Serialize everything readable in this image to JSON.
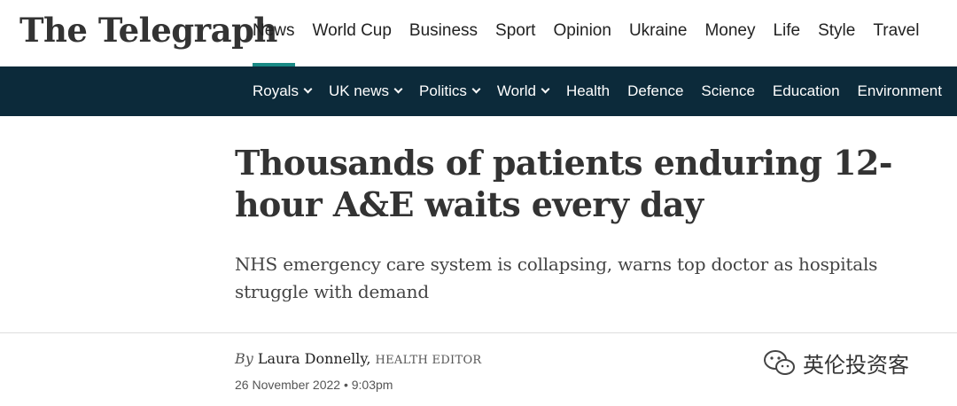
{
  "brand": {
    "logo_text": "The Telegraph"
  },
  "main_nav": [
    {
      "label": "News",
      "active": true
    },
    {
      "label": "World Cup"
    },
    {
      "label": "Business"
    },
    {
      "label": "Sport"
    },
    {
      "label": "Opinion"
    },
    {
      "label": "Ukraine"
    },
    {
      "label": "Money"
    },
    {
      "label": "Life"
    },
    {
      "label": "Style"
    },
    {
      "label": "Travel"
    }
  ],
  "sub_nav": [
    {
      "label": "Royals",
      "dropdown": true
    },
    {
      "label": "UK news",
      "dropdown": true
    },
    {
      "label": "Politics",
      "dropdown": true
    },
    {
      "label": "World",
      "dropdown": true
    },
    {
      "label": "Health"
    },
    {
      "label": "Defence"
    },
    {
      "label": "Science"
    },
    {
      "label": "Education"
    },
    {
      "label": "Environment"
    }
  ],
  "article": {
    "headline": "Thousands of patients enduring 12-hour A&E waits every day",
    "standfirst": "NHS emergency care system is collapsing, warns top doctor as hospitals struggle with demand",
    "byline_prefix": "By",
    "author": "Laura Donnelly,",
    "author_role": "HEALTH EDITOR",
    "date": "26 November 2022 • 9:03pm"
  },
  "watermark": {
    "text": "英伦投资客",
    "icon": "wechat-icon"
  },
  "colors": {
    "subnav_bg": "#0c2a3a",
    "active_underline": "#1a8a85",
    "text_dark": "#333333"
  }
}
